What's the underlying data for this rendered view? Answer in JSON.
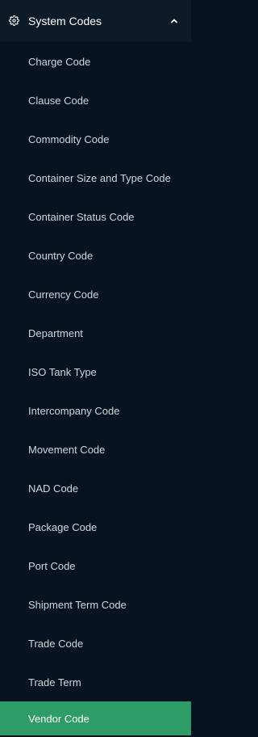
{
  "section": {
    "title": "System Codes",
    "icon": "gear-icon",
    "toggle_icon": "chevron-up-icon",
    "expanded": true
  },
  "menu": {
    "items": [
      {
        "label": "Charge Code"
      },
      {
        "label": "Clause Code"
      },
      {
        "label": "Commodity Code"
      },
      {
        "label": "Container Size and Type Code"
      },
      {
        "label": "Container Status Code"
      },
      {
        "label": "Country Code"
      },
      {
        "label": "Currency Code"
      },
      {
        "label": "Department"
      },
      {
        "label": "ISO Tank Type"
      },
      {
        "label": "Intercompany Code"
      },
      {
        "label": "Movement Code"
      },
      {
        "label": "NAD Code"
      },
      {
        "label": "Package Code"
      },
      {
        "label": "Port Code"
      },
      {
        "label": "Shipment Term Code"
      },
      {
        "label": "Trade Code"
      },
      {
        "label": "Trade Term"
      },
      {
        "label": "Vendor Code"
      }
    ],
    "active_label": "Vendor Code"
  },
  "colors": {
    "background": "#061320",
    "header_background": "#0d1a27",
    "active_background": "#2e9c67",
    "text": "#cfd6dc",
    "header_text": "#ffffff"
  }
}
